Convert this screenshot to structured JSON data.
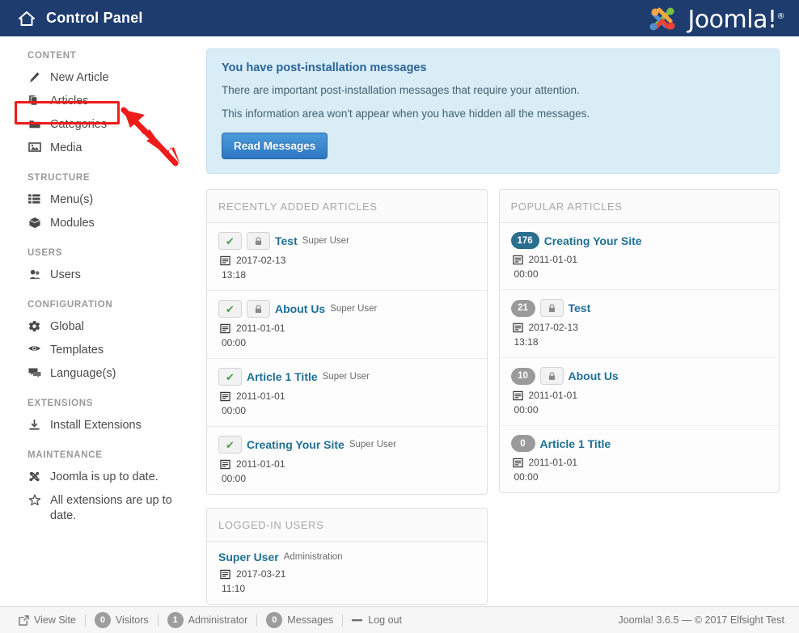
{
  "header": {
    "title": "Control Panel",
    "home_icon": "home-icon",
    "brand_text": "Joomla!",
    "brand_reg": "®",
    "bg_color": "#1e3c6e"
  },
  "sidebar": {
    "groups": [
      {
        "title": "CONTENT",
        "items": [
          {
            "label": "New Article",
            "icon": "pencil-icon"
          },
          {
            "label": "Articles",
            "icon": "copy-icon",
            "highlighted": true
          },
          {
            "label": "Categories",
            "icon": "folder-icon"
          },
          {
            "label": "Media",
            "icon": "image-icon"
          }
        ]
      },
      {
        "title": "STRUCTURE",
        "items": [
          {
            "label": "Menu(s)",
            "icon": "list-icon"
          },
          {
            "label": "Modules",
            "icon": "cube-icon"
          }
        ]
      },
      {
        "title": "USERS",
        "items": [
          {
            "label": "Users",
            "icon": "users-icon"
          }
        ]
      },
      {
        "title": "CONFIGURATION",
        "items": [
          {
            "label": "Global",
            "icon": "gear-icon"
          },
          {
            "label": "Templates",
            "icon": "eye-icon"
          },
          {
            "label": "Language(s)",
            "icon": "comments-icon"
          }
        ]
      },
      {
        "title": "EXTENSIONS",
        "items": [
          {
            "label": "Install Extensions",
            "icon": "download-icon"
          }
        ]
      },
      {
        "title": "MAINTENANCE",
        "items": [
          {
            "label": "Joomla is up to date.",
            "icon": "joomla-icon"
          },
          {
            "label": "All extensions are up to date.",
            "icon": "star-icon"
          }
        ]
      }
    ]
  },
  "alert": {
    "title": "You have post-installation messages",
    "line1": "There are important post-installation messages that require your attention.",
    "line2": "This information area won't appear when you have hidden all the messages.",
    "button_label": "Read Messages",
    "bg_color": "#d9edf7",
    "title_color": "#2a6496"
  },
  "panels": {
    "recent": {
      "heading": "RECENTLY ADDED ARTICLES",
      "rows": [
        {
          "published": true,
          "locked": true,
          "title": "Test",
          "author": "Super User",
          "date": "2017-02-13",
          "time": "13:18"
        },
        {
          "published": true,
          "locked": true,
          "title": "About Us",
          "author": "Super User",
          "date": "2011-01-01",
          "time": "00:00"
        },
        {
          "published": true,
          "locked": false,
          "title": "Article 1 Title",
          "author": "Super User",
          "date": "2011-01-01",
          "time": "00:00"
        },
        {
          "published": true,
          "locked": false,
          "title": "Creating Your Site",
          "author": "Super User",
          "date": "2011-01-01",
          "time": "00:00"
        }
      ]
    },
    "popular": {
      "heading": "POPULAR ARTICLES",
      "rows": [
        {
          "hits": "176",
          "hot": true,
          "locked": false,
          "title": "Creating Your Site",
          "date": "2011-01-01",
          "time": "00:00"
        },
        {
          "hits": "21",
          "hot": false,
          "locked": true,
          "title": "Test",
          "date": "2017-02-13",
          "time": "13:18"
        },
        {
          "hits": "10",
          "hot": false,
          "locked": true,
          "title": "About Us",
          "date": "2011-01-01",
          "time": "00:00"
        },
        {
          "hits": "0",
          "hot": false,
          "locked": false,
          "title": "Article 1 Title",
          "date": "2011-01-01",
          "time": "00:00"
        }
      ]
    },
    "logged_in": {
      "heading": "LOGGED-IN USERS",
      "rows": [
        {
          "name": "Super User",
          "role": "Administration",
          "date": "2017-03-21",
          "time": "11:10"
        }
      ]
    }
  },
  "footer": {
    "view_site": "View Site",
    "visitors_count": "0",
    "visitors_label": "Visitors",
    "admin_count": "1",
    "admin_label": "Administrator",
    "messages_count": "0",
    "messages_label": "Messages",
    "logout": "Log out",
    "copyright": "Joomla! 3.6.5  —  © 2017 Elfsight Test"
  },
  "annotation": {
    "highlight_color": "#ee1b1b",
    "target": "sidebar-item-articles"
  }
}
